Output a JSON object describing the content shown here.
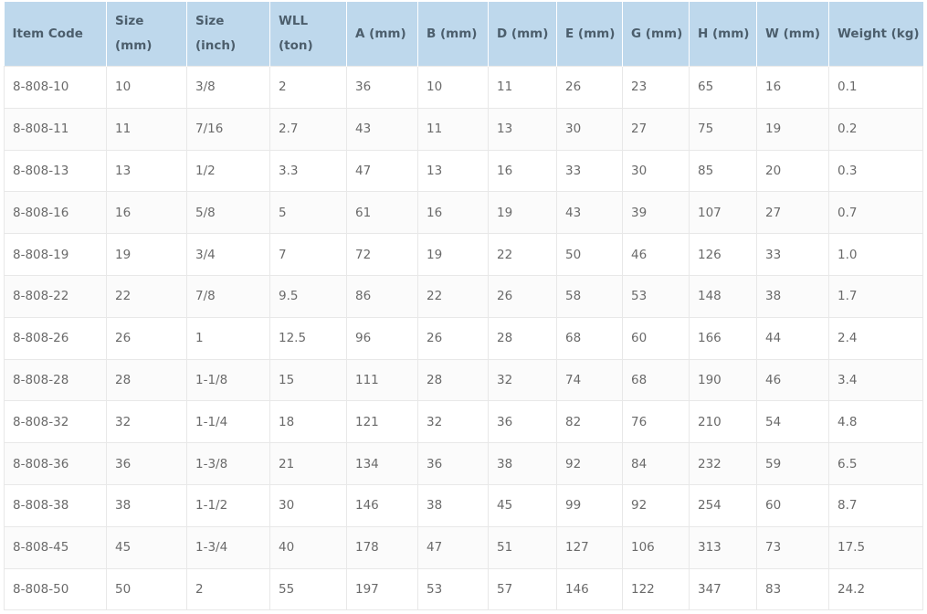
{
  "table": {
    "headers": [
      [
        "Item Code"
      ],
      [
        "Size",
        "(mm)"
      ],
      [
        "Size",
        "(inch)"
      ],
      [
        "WLL",
        "(ton)"
      ],
      [
        "A (mm)"
      ],
      [
        "B (mm)"
      ],
      [
        "D (mm)"
      ],
      [
        "E (mm)"
      ],
      [
        "G (mm)"
      ],
      [
        "H (mm)"
      ],
      [
        "W (mm)"
      ],
      [
        "Weight (kg)"
      ]
    ],
    "rows": [
      [
        "8-808-10",
        "10",
        "3/8",
        "2",
        "36",
        "10",
        "11",
        "26",
        "23",
        "65",
        "16",
        "0.1"
      ],
      [
        "8-808-11",
        "11",
        "7/16",
        "2.7",
        "43",
        "11",
        "13",
        "30",
        "27",
        "75",
        "19",
        "0.2"
      ],
      [
        "8-808-13",
        "13",
        "1/2",
        "3.3",
        "47",
        "13",
        "16",
        "33",
        "30",
        "85",
        "20",
        "0.3"
      ],
      [
        "8-808-16",
        "16",
        "5/8",
        "5",
        "61",
        "16",
        "19",
        "43",
        "39",
        "107",
        "27",
        "0.7"
      ],
      [
        "8-808-19",
        "19",
        "3/4",
        "7",
        "72",
        "19",
        "22",
        "50",
        "46",
        "126",
        "33",
        "1.0"
      ],
      [
        "8-808-22",
        "22",
        "7/8",
        "9.5",
        "86",
        "22",
        "26",
        "58",
        "53",
        "148",
        "38",
        "1.7"
      ],
      [
        "8-808-26",
        "26",
        "1",
        "12.5",
        "96",
        "26",
        "28",
        "68",
        "60",
        "166",
        "44",
        "2.4"
      ],
      [
        "8-808-28",
        "28",
        "1-1/8",
        "15",
        "111",
        "28",
        "32",
        "74",
        "68",
        "190",
        "46",
        "3.4"
      ],
      [
        "8-808-32",
        "32",
        "1-1/4",
        "18",
        "121",
        "32",
        "36",
        "82",
        "76",
        "210",
        "54",
        "4.8"
      ],
      [
        "8-808-36",
        "36",
        "1-3/8",
        "21",
        "134",
        "36",
        "38",
        "92",
        "84",
        "232",
        "59",
        "6.5"
      ],
      [
        "8-808-38",
        "38",
        "1-1/2",
        "30",
        "146",
        "38",
        "45",
        "99",
        "92",
        "254",
        "60",
        "8.7"
      ],
      [
        "8-808-45",
        "45",
        "1-3/4",
        "40",
        "178",
        "47",
        "51",
        "127",
        "106",
        "313",
        "73",
        "17.5"
      ],
      [
        "8-808-50",
        "50",
        "2",
        "55",
        "197",
        "53",
        "57",
        "146",
        "122",
        "347",
        "83",
        "24.2"
      ]
    ]
  }
}
